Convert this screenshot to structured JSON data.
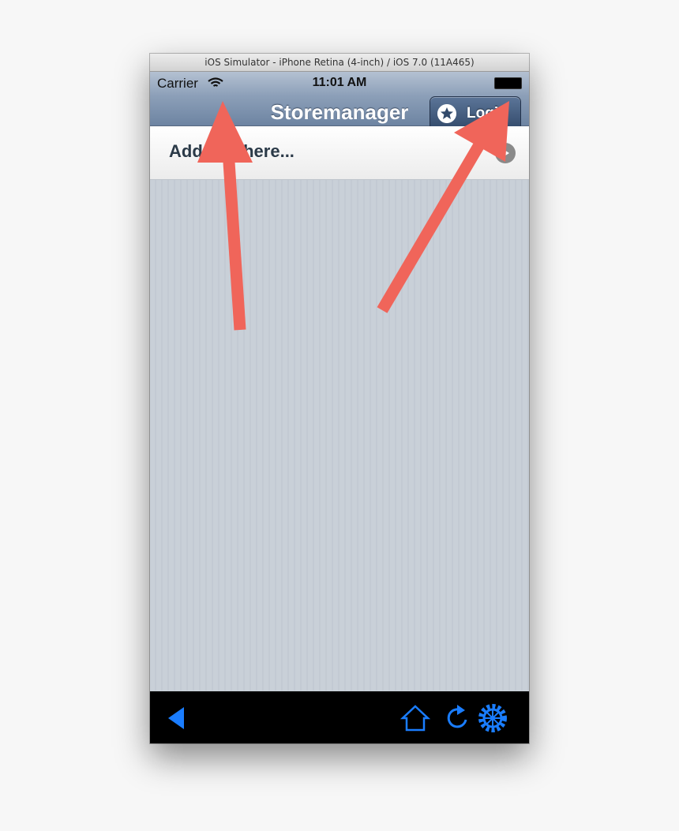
{
  "window": {
    "title": "iOS Simulator - iPhone Retina (4-inch) / iOS 7.0 (11A465)"
  },
  "status_bar": {
    "carrier": "Carrier",
    "time": "11:01 AM"
  },
  "navbar": {
    "title": "Storemanager",
    "login_label": "Login"
  },
  "add_row": {
    "placeholder": "Add text here..."
  },
  "toolbar": {
    "icons": [
      "back-icon",
      "home-icon",
      "refresh-icon",
      "settings-icon"
    ]
  },
  "colors": {
    "arrow": "#f0655a",
    "toolbar_icon": "#1a7dff",
    "navbar": "#8c9fb8"
  }
}
